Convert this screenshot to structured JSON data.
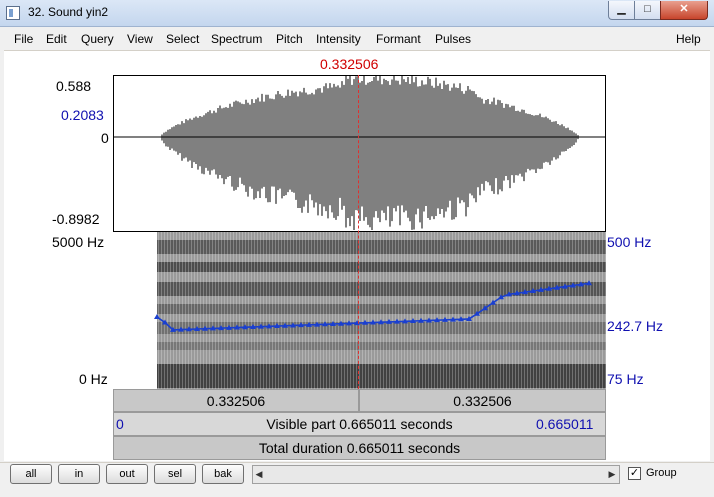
{
  "window": {
    "title": "32. Sound yin2",
    "minimize_glyph": "▁",
    "maximize_glyph": "□",
    "close_glyph": "✕"
  },
  "menu": [
    "File",
    "Edit",
    "Query",
    "View",
    "Select",
    "Spectrum",
    "Pitch",
    "Intensity",
    "Formant",
    "Pulses"
  ],
  "help": "Help",
  "cursor": {
    "time_label": "0.332506",
    "time_fraction": 0.5
  },
  "waveform": {
    "y_max": "0.588",
    "y_cursor": "0.2083",
    "y_zero": "0",
    "y_min": "-0.8982"
  },
  "spectrogram": {
    "freq_top": "5000 Hz",
    "freq_bottom": "0 Hz",
    "pitch_top": "500 Hz",
    "pitch_mid": "242.7 Hz",
    "pitch_bottom": "75 Hz"
  },
  "time_bar": {
    "left_label": "0.332506",
    "right_label": "0.332506"
  },
  "visible_bar": {
    "start": "0",
    "text": "Visible part 0.665011 seconds",
    "end": "0.665011"
  },
  "total_bar": {
    "text": "Total duration 0.665011 seconds"
  },
  "buttons": {
    "all": "all",
    "in": "in",
    "out": "out",
    "sel": "sel",
    "bak": "bak"
  },
  "scroll": {
    "left_arrow": "◀",
    "right_arrow": "▶"
  },
  "group": {
    "label": "Group",
    "checked": "✓"
  }
}
